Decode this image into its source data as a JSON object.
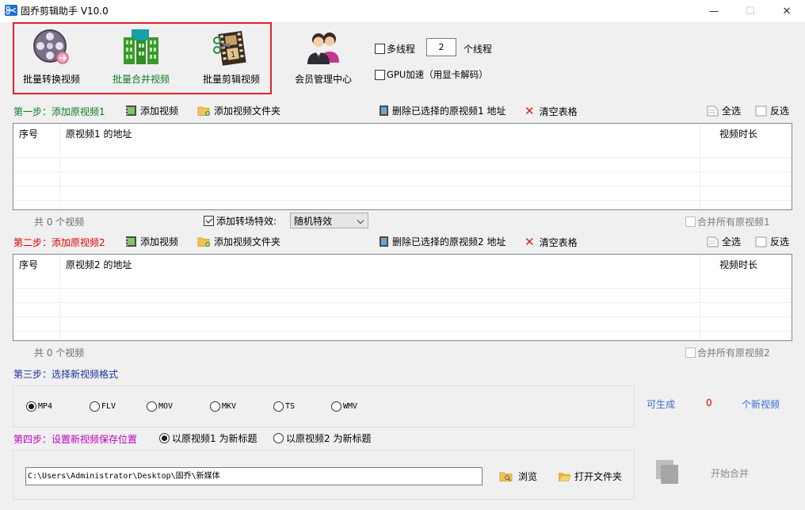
{
  "window": {
    "title": "固乔剪辑助手 V10.0",
    "minimize": "—",
    "maximize": "☐",
    "close": "✕"
  },
  "toolbar": {
    "batch_convert": "批量转换视频",
    "batch_merge": "批量合并视频",
    "batch_cut": "批量剪辑视频",
    "member_center": "会员管理中心"
  },
  "options": {
    "multithread_label": "多线程",
    "multithread_checked": false,
    "thread_count": "2",
    "thread_unit": "个线程",
    "gpu_label": "GPU加速（用显卡解码）",
    "gpu_checked": false
  },
  "step1": {
    "label": "第一步：添加原视频1",
    "add_video": "添加视频",
    "add_folder": "添加视频文件夹",
    "delete_selected": "删除已选择的原视频1 地址",
    "clear_table": "清空表格",
    "select_all": "全选",
    "invert": "反选",
    "columns": {
      "index": "序号",
      "address": "原视频1 的地址",
      "duration": "视频时长"
    },
    "count_text": "共 0 个视频",
    "transition_label": "添加转场特效:",
    "transition_checked": true,
    "transition_value": "随机特效",
    "merge_all": "合并所有原视频1",
    "merge_all_checked": false
  },
  "step2": {
    "label": "第二步：添加原视频2",
    "add_video": "添加视频",
    "add_folder": "添加视频文件夹",
    "delete_selected": "删除已选择的原视频2 地址",
    "clear_table": "清空表格",
    "select_all": "全选",
    "invert": "反选",
    "columns": {
      "index": "序号",
      "address": "原视频2 的地址",
      "duration": "视频时长"
    },
    "count_text": "共 0 个视频",
    "merge_all": "合并所有原视频2",
    "merge_all_checked": false
  },
  "step3": {
    "label": "第三步：选择新视频格式",
    "formats": [
      "MP4",
      "FLV",
      "MOV",
      "MKV",
      "TS",
      "WMV"
    ],
    "selected_format": "MP4",
    "can_generate": "可生成",
    "generate_count": "0",
    "generate_unit": "个新视频"
  },
  "step4": {
    "label": "第四步：设置新视频保存位置",
    "title_option1": "以原视频1 为新标题",
    "title_option2": "以原视频2 为新标题",
    "selected_title_option": 1,
    "save_path": "C:\\Users\\Administrator\\Desktop\\固乔\\新媒体",
    "browse": "浏览",
    "open_folder": "打开文件夹",
    "start_merge": "开始合并"
  },
  "colors": {
    "highlight_frame": "#e5202a",
    "step1_green": "#0c7b22",
    "step2_red": "#e00000",
    "step3_blue": "#1b2f9e",
    "step4_magenta": "#c000c0",
    "link_blue": "#3a6ad4"
  }
}
